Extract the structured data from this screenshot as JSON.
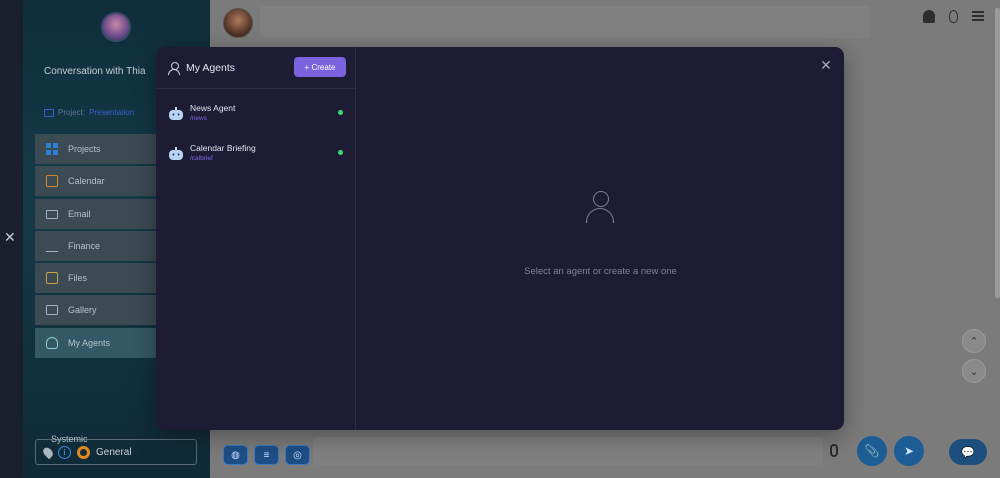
{
  "sidebar": {
    "title": "Conversation with Thia",
    "project_label": "Project:",
    "project_value": "Presentation",
    "items": [
      {
        "label": "Projects"
      },
      {
        "label": "Calendar"
      },
      {
        "label": "Email"
      },
      {
        "label": "Finance"
      },
      {
        "label": "Files"
      },
      {
        "label": "Gallery"
      },
      {
        "label": "My Agents",
        "active": true
      }
    ],
    "bottom_caption": "Systemic",
    "bottom_value": "General"
  },
  "main": {
    "chips": [
      "◍",
      "≡",
      "◎"
    ],
    "scroll_up": "⌃",
    "scroll_down": "⌄",
    "attach_icon": "📎",
    "send_icon": "➤",
    "chat_icon": "💬"
  },
  "modal": {
    "title": "My Agents",
    "create_label": "+ Create",
    "close_glyph": "✕",
    "agents": [
      {
        "name": "News Agent",
        "command": "/news",
        "status": "active"
      },
      {
        "name": "Calendar Briefing",
        "command": "/calbrief",
        "status": "active"
      }
    ],
    "empty_text": "Select an agent or create a new one"
  },
  "edge": {
    "close_glyph": "✕"
  },
  "colors": {
    "accent": "#7a63dd",
    "status_active": "#3ddc6f",
    "modal_bg": "#1e1b34"
  }
}
